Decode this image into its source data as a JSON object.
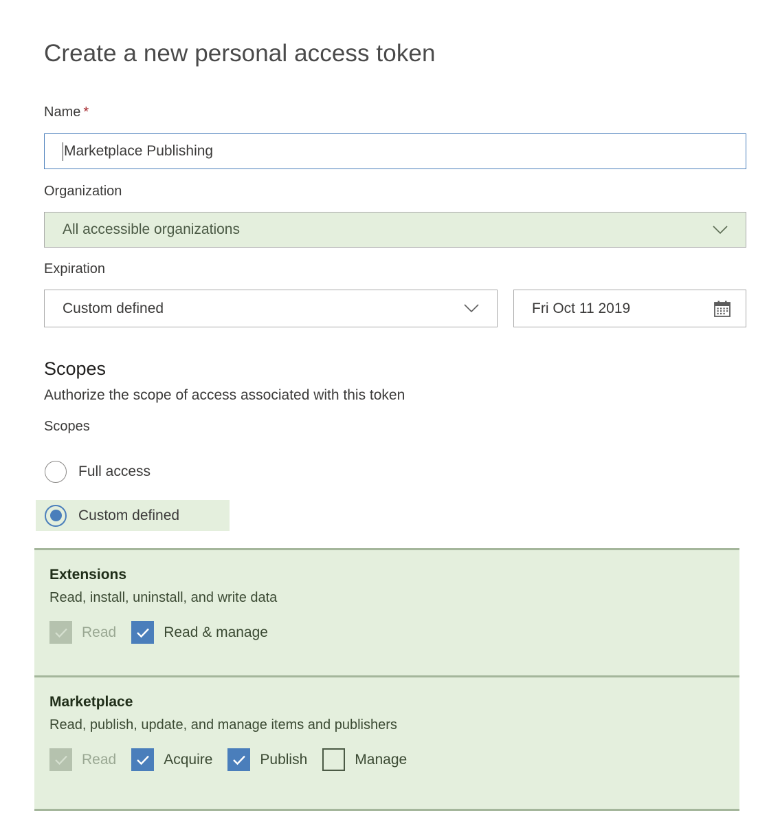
{
  "page": {
    "title": "Create a new personal access token"
  },
  "name_field": {
    "label": "Name",
    "required_marker": "*",
    "value": "Marketplace Publishing"
  },
  "organization_field": {
    "label": "Organization",
    "value": "All accessible organizations",
    "chevron_icon": "chevron-down-icon"
  },
  "expiration_field": {
    "label": "Expiration",
    "preset_value": "Custom defined",
    "chevron_icon": "chevron-down-icon",
    "date_value": "Fri Oct 11 2019",
    "calendar_icon": "calendar-icon"
  },
  "scopes_section": {
    "heading": "Scopes",
    "subheading": "Authorize the scope of access associated with this token",
    "field_label": "Scopes",
    "radios": [
      {
        "label": "Full access",
        "selected": false
      },
      {
        "label": "Custom defined",
        "selected": true
      }
    ],
    "blocks": [
      {
        "title": "Extensions",
        "description": "Read, install, uninstall, and write data",
        "options": [
          {
            "label": "Read",
            "state": "disabled-checked"
          },
          {
            "label": "Read & manage",
            "state": "checked"
          }
        ]
      },
      {
        "title": "Marketplace",
        "description": "Read, publish, update, and manage items and publishers",
        "options": [
          {
            "label": "Read",
            "state": "disabled-checked"
          },
          {
            "label": "Acquire",
            "state": "checked"
          },
          {
            "label": "Publish",
            "state": "checked"
          },
          {
            "label": "Manage",
            "state": "unchecked"
          }
        ]
      }
    ]
  },
  "colors": {
    "accent_blue": "#4a7ebb",
    "highlight_green": "#e4efdd",
    "divider_green": "#a4b69b",
    "required_red": "#a4262c",
    "disabled_checkbox": "#b5c2ae"
  }
}
